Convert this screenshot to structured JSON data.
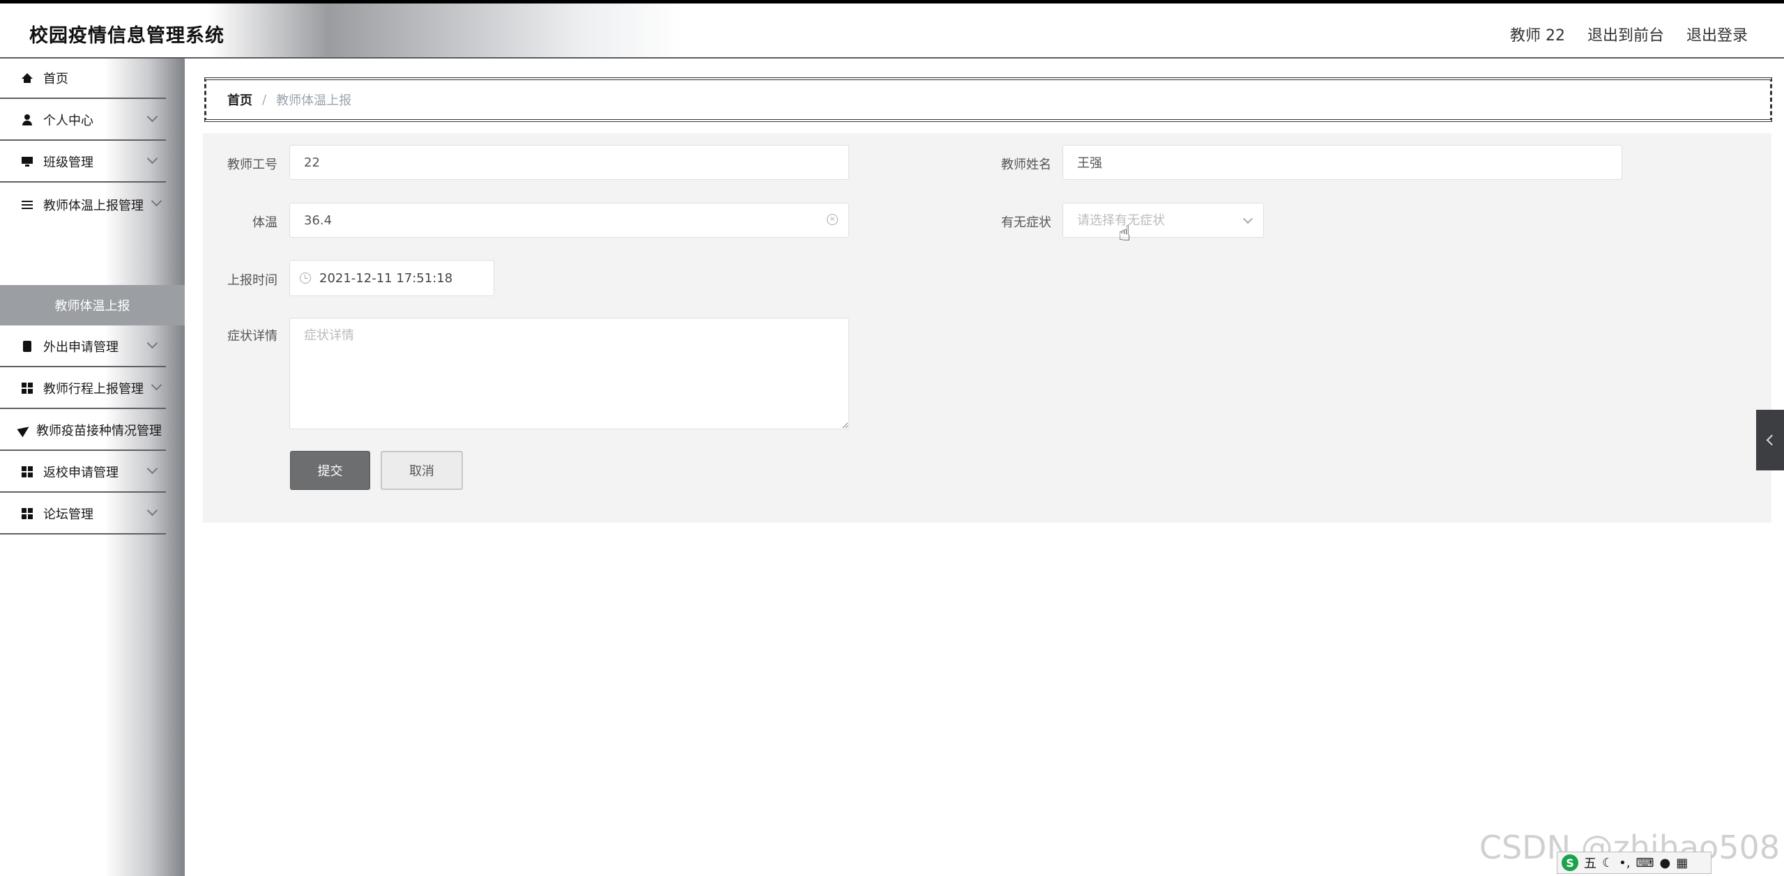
{
  "header": {
    "title": "校园疫情信息管理系统",
    "user": "教师 22",
    "to_front": "退出到前台",
    "logout": "退出登录"
  },
  "sidebar": {
    "items": [
      {
        "label": "首页",
        "icon": "home-icon"
      },
      {
        "label": "个人中心",
        "icon": "user-icon"
      },
      {
        "label": "班级管理",
        "icon": "monitor-icon"
      },
      {
        "label": "教师体温上报管理",
        "icon": "sliders-icon"
      },
      {
        "label": "外出申请管理",
        "icon": "clipboard-icon"
      },
      {
        "label": "教师行程上报管理",
        "icon": "grid-icon"
      },
      {
        "label": "教师疫苗接种情况管理",
        "icon": "paper-plane-icon"
      },
      {
        "label": "返校申请管理",
        "icon": "grid-icon"
      },
      {
        "label": "论坛管理",
        "icon": "grid-icon"
      }
    ],
    "active_sub": "教师体温上报"
  },
  "breadcrumb": {
    "home": "首页",
    "separator": "/",
    "current": "教师体温上报"
  },
  "form": {
    "teacher_id_label": "教师工号",
    "teacher_id_value": "22",
    "teacher_name_label": "教师姓名",
    "teacher_name_value": "王强",
    "temperature_label": "体温",
    "temperature_value": "36.4",
    "symptom_label": "有无症状",
    "symptom_placeholder": "请选择有无症状",
    "report_time_label": "上报时间",
    "report_time_value": "2021-12-11 17:51:18",
    "details_label": "症状详情",
    "details_placeholder": "症状详情",
    "submit_label": "提交",
    "cancel_label": "取消"
  },
  "watermark": "CSDN @zhihao508",
  "ime": {
    "glyph": "五",
    "logo": "S"
  },
  "colors": {
    "accent_button": "#6d6e70",
    "panel_bg": "#f3f3f3"
  }
}
